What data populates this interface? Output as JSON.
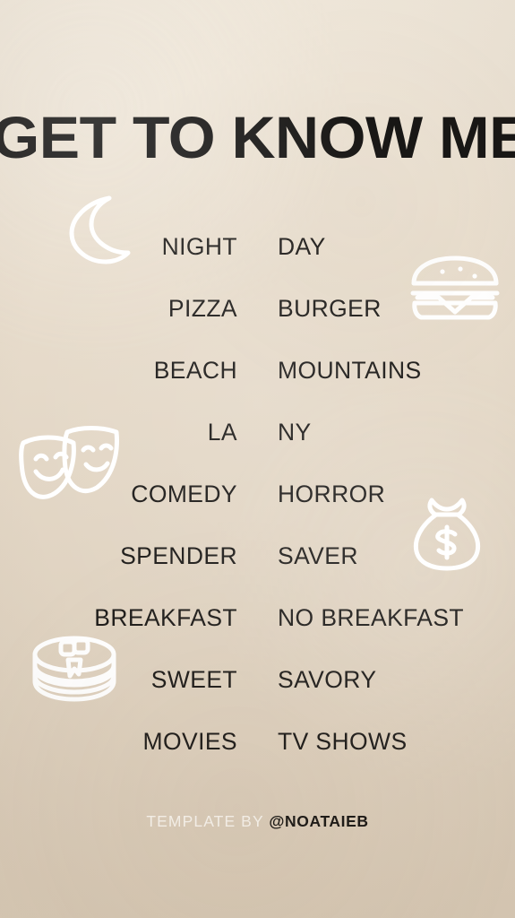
{
  "story": {
    "title": "GET TO KNOW ME",
    "background_top_color": "#F1E9DC",
    "background_bottom_color": "#DACBB7",
    "text_color": "#1D1B19",
    "icon_color": "#FFFFFF"
  },
  "rows": [
    {
      "left": "NIGHT",
      "right": "DAY"
    },
    {
      "left": "PIZZA",
      "right": "BURGER"
    },
    {
      "left": "BEACH",
      "right": "MOUNTAINS"
    },
    {
      "left": "LA",
      "right": "NY"
    },
    {
      "left": "COMEDY",
      "right": "HORROR"
    },
    {
      "left": "SPENDER",
      "right": "SAVER"
    },
    {
      "left": "BREAKFAST",
      "right": "NO BREAKFAST"
    },
    {
      "left": "SWEET",
      "right": "SAVORY"
    },
    {
      "left": "MOVIES",
      "right": "TV SHOWS"
    }
  ],
  "icons": [
    {
      "name": "moon-icon",
      "label": "crescent moon",
      "row": "NIGHT / DAY",
      "side": "left"
    },
    {
      "name": "burger-icon",
      "label": "hamburger",
      "row": "PIZZA / BURGER",
      "side": "right"
    },
    {
      "name": "theater-masks-icon",
      "label": "theater masks",
      "row": "COMEDY / HORROR",
      "side": "left"
    },
    {
      "name": "money-bag-icon",
      "label": "money bag",
      "row": "SPENDER / SAVER",
      "side": "right"
    },
    {
      "name": "pancakes-icon",
      "label": "stack of pancakes",
      "row": "SWEET / SAVORY",
      "side": "left"
    }
  ],
  "footer": {
    "prefix": "TEMPLATE BY ",
    "handle": "@NOATAIEB"
  }
}
